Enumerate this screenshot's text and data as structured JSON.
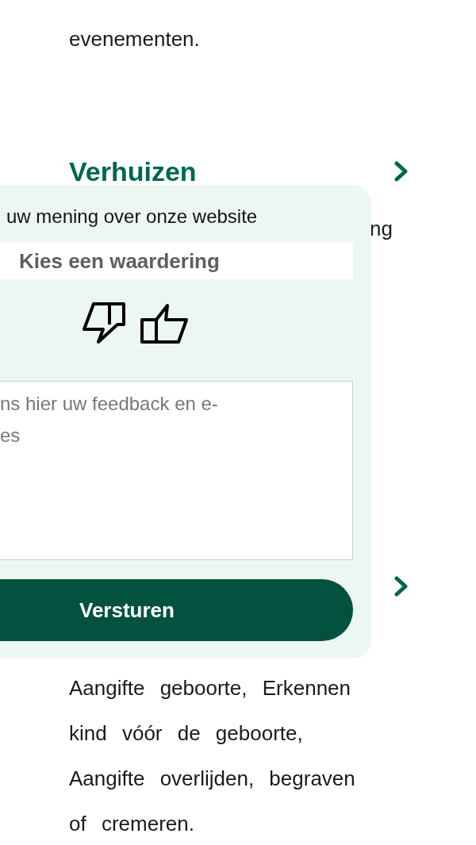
{
  "intro_text": "evenementen.",
  "sections": [
    {
      "title": "Verhuizen",
      "description": "ng"
    },
    {
      "description": "Aangifte geboorte, Erkennen kind vóór de geboorte, Aangifte overlijden, begraven of cremeren."
    }
  ],
  "feedback": {
    "title": "uw mening over onze website",
    "rating_select": "Kies een waardering",
    "feedback_field": {
      "placeholder": "ns hier uw feedback en e-\nes"
    },
    "submit_button": "Versturen"
  }
}
